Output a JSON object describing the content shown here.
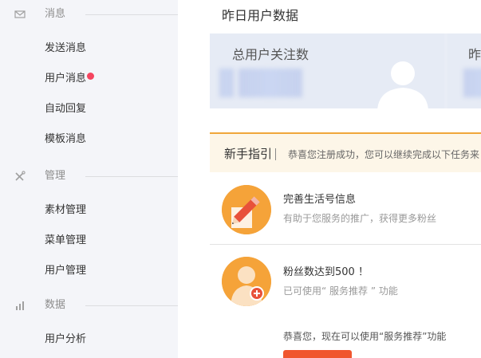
{
  "sidebar": {
    "sections": [
      {
        "label": "消息",
        "icon": "mail-icon"
      },
      {
        "label": "管理",
        "icon": "tools-icon"
      },
      {
        "label": "数据",
        "icon": "bar-chart-icon"
      }
    ],
    "items": [
      {
        "label": "发送消息"
      },
      {
        "label": "用户消息",
        "badge": true
      },
      {
        "label": "自动回复"
      },
      {
        "label": "模板消息"
      },
      {
        "label": "素材管理"
      },
      {
        "label": "菜单管理"
      },
      {
        "label": "用户管理"
      },
      {
        "label": "用户分析"
      }
    ]
  },
  "main": {
    "yesterday_title": "昨日用户数据",
    "stats": [
      {
        "label": "总用户关注数"
      },
      {
        "label": "昨"
      }
    ],
    "guide": {
      "title": "新手指引",
      "description": "恭喜您注册成功，您可以继续完成以下任务来"
    },
    "tasks": [
      {
        "title": "完善生活号信息",
        "subtitle": "有助于您服务的推广，获得更多粉丝"
      },
      {
        "title": "粉丝数达到500 ！",
        "subtitle": "已可使用“ 服务推荐 ” 功能"
      }
    ],
    "congrats": "恭喜您，现在可以使用“服务推荐”功能"
  },
  "colors": {
    "accent_orange": "#f5a339",
    "badge_red": "#f5455f",
    "guide_border": "#f0a63a",
    "cta_red": "#f0562e"
  }
}
